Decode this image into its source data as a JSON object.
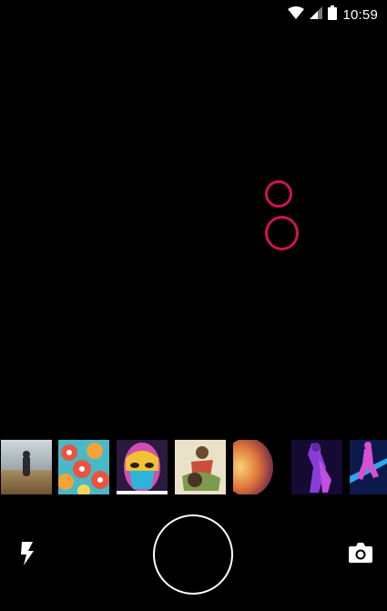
{
  "status_bar": {
    "time": "10:59",
    "icons": [
      "wifi-icon",
      "cell-signal-icon",
      "battery-icon"
    ]
  },
  "viewfinder": {
    "focus_ring_color": "#d0144e"
  },
  "gallery": {
    "thumbnails": [
      "thumbnail-man-in-field",
      "thumbnail-cartoon-pattern",
      "thumbnail-painted-face",
      "thumbnail-sketch-art",
      "thumbnail-planet-art",
      "thumbnail-neon-figure",
      "thumbnail-neon-dancer"
    ]
  },
  "controls": {
    "icons": [
      "flash-icon",
      "shutter-button",
      "switch-camera-icon"
    ]
  }
}
